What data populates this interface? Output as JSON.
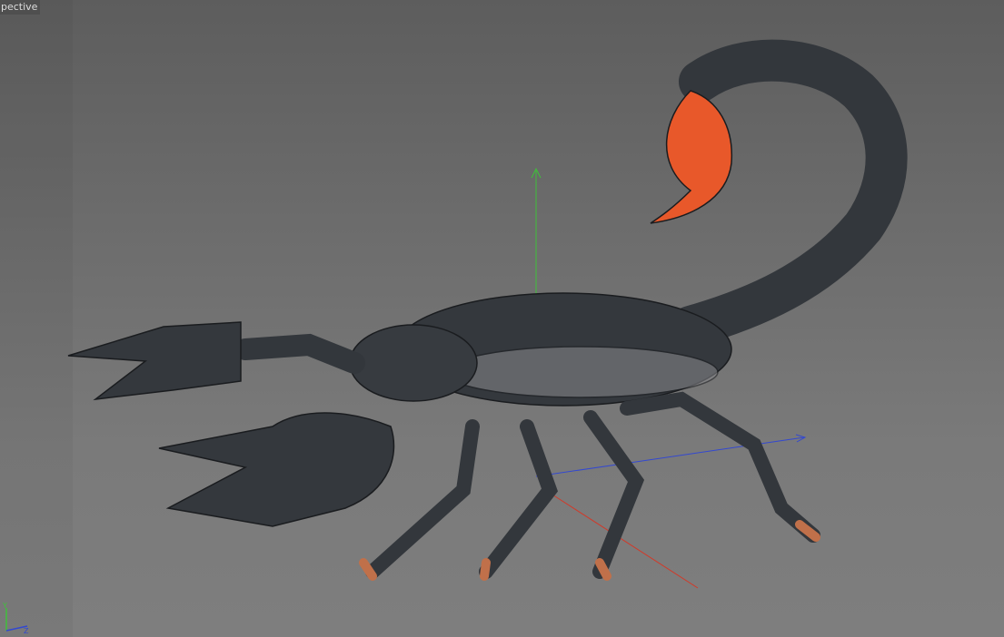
{
  "viewport": {
    "camera_label": "pective",
    "axis_labels": {
      "y": "Y",
      "z": "Z"
    }
  },
  "colors": {
    "axis_x": "#d03a2a",
    "axis_y": "#3fc03a",
    "axis_z": "#3348d0",
    "body": "#2f3236",
    "stinger": "#e8582a"
  }
}
